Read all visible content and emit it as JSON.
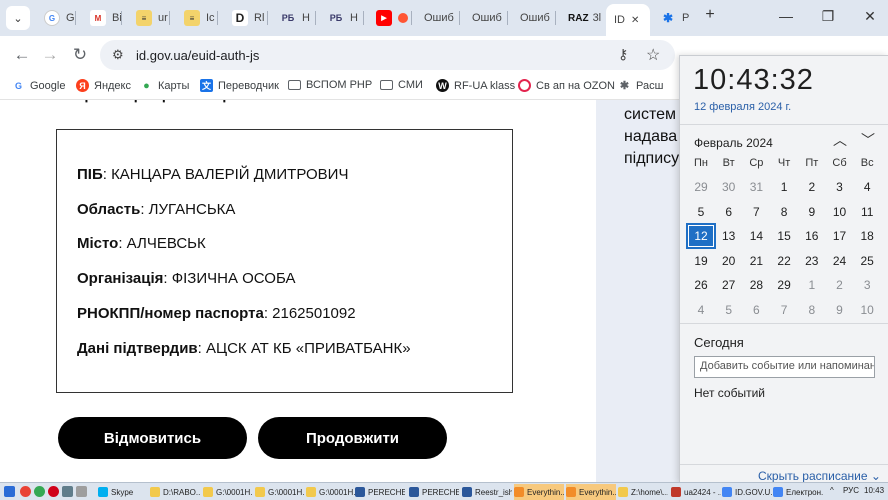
{
  "browser": {
    "tabs": [
      {
        "label": "G",
        "icon": "google-icon",
        "color": "#4285f4",
        "active": false
      },
      {
        "label": "Bi",
        "icon": "gmail-icon",
        "color": "#d93025",
        "active": false
      },
      {
        "label": "ur",
        "icon": "news-icon",
        "color": "#c8a000",
        "active": false
      },
      {
        "label": "Ic",
        "icon": "news-icon",
        "color": "#c8a000",
        "active": false
      },
      {
        "label": "Rl",
        "icon": "d-icon",
        "color": "#222222",
        "active": false
      },
      {
        "label": "H",
        "icon": "rbc-icon",
        "color": "#3a3a6a",
        "active": false
      },
      {
        "label": "H",
        "icon": "rbc-icon",
        "color": "#3a3a6a",
        "active": false
      },
      {
        "label": "",
        "icon": "youtube-icon",
        "color": "#ff0000",
        "active": false
      },
      {
        "label": "Ошиб",
        "icon": "",
        "color": "",
        "active": false
      },
      {
        "label": "Ошиб",
        "icon": "",
        "color": "",
        "active": false
      },
      {
        "label": "Ошиб",
        "icon": "",
        "color": "",
        "active": false
      },
      {
        "label": "3l",
        "icon": "raz-icon",
        "color": "#111111",
        "active": false
      },
      {
        "label": "ID",
        "icon": "",
        "color": "",
        "active": true
      },
      {
        "label": "P",
        "icon": "puzzle-icon",
        "color": "#1a73e8",
        "active": false
      }
    ],
    "raz_label": "RAZ",
    "tab_menu": "⌄",
    "new_tab": "+",
    "close": "✕",
    "url": "id.gov.ua/euid-auth-js"
  },
  "bookmarks": [
    {
      "label": "Google",
      "icon": "google-icon",
      "color": "#4285f4",
      "glyph": "G"
    },
    {
      "label": "Яндекс",
      "icon": "yandex-icon",
      "color": "#fc3f1d",
      "glyph": "Я"
    },
    {
      "label": "Карты",
      "icon": "maps-pin-icon",
      "color": "#34a853",
      "glyph": "●"
    },
    {
      "label": "Переводчик",
      "icon": "translate-icon",
      "color": "#1a73e8",
      "glyph": "文"
    },
    {
      "label": "ВСПОМ РНР",
      "icon": "folder-icon",
      "color": "#5f6368",
      "glyph": "▭"
    },
    {
      "label": "СМИ",
      "icon": "folder-icon",
      "color": "#5f6368",
      "glyph": "▭"
    },
    {
      "label": "RF-UA klass",
      "icon": "rf-icon",
      "color": "#111111",
      "glyph": "W"
    },
    {
      "label": "Св ап на OZON",
      "icon": "ozon-icon",
      "color": "#e3244e",
      "glyph": "O"
    },
    {
      "label": "Расш",
      "icon": "puzzle-icon",
      "color": "#5f6368",
      "glyph": "✱"
    }
  ],
  "page": {
    "rows": [
      {
        "label": "ПІБ",
        "value": ": КАНЦАРА ВАЛЕРІЙ ДМИТРОВИЧ"
      },
      {
        "label": "Область",
        "value": ": ЛУГАНСЬКА"
      },
      {
        "label": "Місто",
        "value": ": АЛЧЕВСЬК"
      },
      {
        "label": "Організація",
        "value": ": ФІЗИЧНА ОСОБА"
      },
      {
        "label": "РНОКПП/номер паспорта",
        "value": ": 2162501092"
      },
      {
        "label": "Дані підтвердив",
        "value": ": АЦСК АТ КБ «ПРИВАТБАНК»"
      }
    ],
    "decline_button": "Відмовитись",
    "continue_button": "Продовжити",
    "side_text": [
      "систем",
      "надава",
      "підпису"
    ]
  },
  "calendar": {
    "time": "10:43:32",
    "date": "12 февраля 2024 г.",
    "month": "Февраль 2024",
    "weekdays": [
      "Пн",
      "Вт",
      "Ср",
      "Чт",
      "Пт",
      "Сб",
      "Вс"
    ],
    "weeks": [
      [
        "29",
        "30",
        "31",
        "1",
        "2",
        "3",
        "4"
      ],
      [
        "5",
        "6",
        "7",
        "8",
        "9",
        "10",
        "11"
      ],
      [
        "12",
        "13",
        "14",
        "15",
        "16",
        "17",
        "18"
      ],
      [
        "19",
        "20",
        "21",
        "22",
        "23",
        "24",
        "25"
      ],
      [
        "26",
        "27",
        "28",
        "29",
        "1",
        "2",
        "3"
      ],
      [
        "4",
        "5",
        "6",
        "7",
        "8",
        "9",
        "10"
      ]
    ],
    "today": "12",
    "today_label": "Сегодня",
    "add_event_placeholder": "Добавить событие или напоминание",
    "no_events": "Нет событий",
    "show_schedule": "Скрыть расписание ⌄"
  },
  "taskbar": {
    "items": [
      {
        "label": "Skype",
        "color": "#00aff0",
        "highlight": false
      },
      {
        "label": "D:\\RABO...",
        "color": "#f2c94c",
        "highlight": false
      },
      {
        "label": "G:\\0001H...",
        "color": "#f2c94c",
        "highlight": false
      },
      {
        "label": "G:\\0001H...",
        "color": "#f2c94c",
        "highlight": false
      },
      {
        "label": "G:\\0001H...",
        "color": "#f2c94c",
        "highlight": false
      },
      {
        "label": "PERECHE...",
        "color": "#2b579a",
        "highlight": false
      },
      {
        "label": "PERECHE...",
        "color": "#2b579a",
        "highlight": false
      },
      {
        "label": "Reestr_ish...",
        "color": "#2b579a",
        "highlight": false
      },
      {
        "label": "Everythin...",
        "color": "#f28c28",
        "highlight": true
      },
      {
        "label": "Everythin...",
        "color": "#f28c28",
        "highlight": true
      },
      {
        "label": "Z:\\home\\...",
        "color": "#f2c94c",
        "highlight": false
      },
      {
        "label": "ua2424 - ...",
        "color": "#c0392b",
        "highlight": false
      },
      {
        "label": "ID.GOV.U...",
        "color": "#4285f4",
        "highlight": false
      },
      {
        "label": "Електрон...",
        "color": "#4285f4",
        "highlight": false
      }
    ],
    "lang": "РУС",
    "clock": "10:43"
  }
}
